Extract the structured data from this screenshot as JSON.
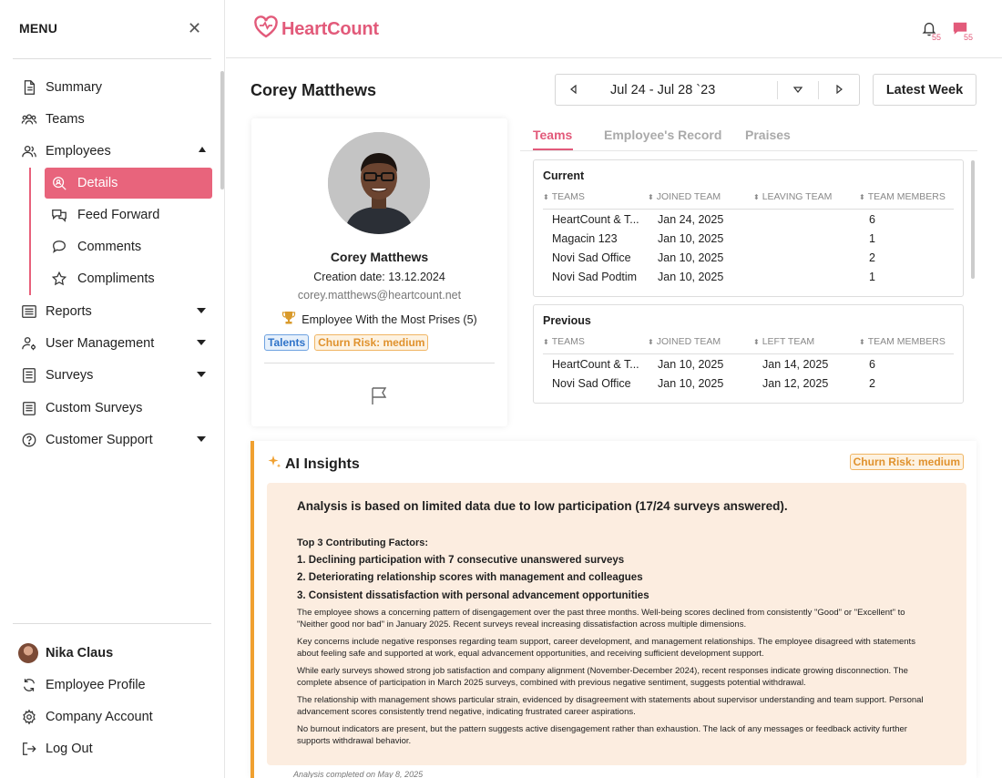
{
  "sidebar": {
    "menu_title": "MENU",
    "close_glyph": "✕",
    "nav": [
      {
        "label": "Summary",
        "icon": "document-icon"
      },
      {
        "label": "Teams",
        "icon": "teams-icon"
      },
      {
        "label": "Employees",
        "icon": "employees-icon"
      }
    ],
    "employees_sub": [
      {
        "label": "Details",
        "icon": "search-user-icon",
        "active": true
      },
      {
        "label": "Feed Forward",
        "icon": "chat-bubbles-icon"
      },
      {
        "label": "Comments",
        "icon": "comment-icon"
      },
      {
        "label": "Compliments",
        "icon": "star-icon"
      }
    ],
    "nav_after": [
      {
        "label": "Reports",
        "icon": "list-icon"
      },
      {
        "label": "User Management",
        "icon": "user-settings-icon"
      },
      {
        "label": "Surveys",
        "icon": "survey-icon"
      },
      {
        "label": "Custom Surveys",
        "icon": "clipboard-icon"
      },
      {
        "label": "Customer Support",
        "icon": "help-icon"
      }
    ],
    "bottom": {
      "user_name": "Nika Claus",
      "employee_profile": "Employee Profile",
      "company_account": "Company Account",
      "log_out": "Log Out"
    }
  },
  "header": {
    "logo_text": "HeartCount",
    "notifications_count": "55",
    "messages_count": "55",
    "brand_color": "#e25a7a"
  },
  "page": {
    "title": "Corey Matthews",
    "date_range": "Jul 24 - Jul 28 `23",
    "latest_week": "Latest Week"
  },
  "profile": {
    "name": "Corey Matthews",
    "creation_date": "Creation date: 13.12.2024",
    "email": "corey.matthews@heartcount.net",
    "award": "Employee With the Most Prises (5)",
    "tags": {
      "talents": "Talents",
      "churn": "Churn Risk: medium"
    }
  },
  "tabs": [
    "Teams",
    "Employee's Record",
    "Praises"
  ],
  "current": {
    "title": "Current",
    "headers": [
      "TEAMS",
      "JOINED TEAM",
      "LEAVING TEAM",
      "TEAM MEMBERS"
    ],
    "rows": [
      [
        "HeartCount & T...",
        "Jan 24, 2025",
        "",
        "6"
      ],
      [
        "Magacin 123",
        "Jan 10, 2025",
        "",
        "1"
      ],
      [
        "Novi Sad Office",
        "Jan 10, 2025",
        "",
        "2"
      ],
      [
        "Novi Sad Podtim",
        "Jan 10, 2025",
        "",
        "1"
      ]
    ]
  },
  "previous": {
    "title": "Previous",
    "headers": [
      "TEAMS",
      "JOINED TEAM",
      "LEFT TEAM",
      "TEAM MEMBERS"
    ],
    "rows": [
      [
        "HeartCount & T...",
        "Jan 10, 2025",
        "Jan 14, 2025",
        "6"
      ],
      [
        "Novi Sad Office",
        "Jan 10, 2025",
        "Jan 12, 2025",
        "2"
      ]
    ]
  },
  "ai": {
    "title": "AI Insights",
    "badge": "Churn Risk: medium",
    "lead": "Analysis is based on limited data due to low participation (17/24 surveys answered).",
    "factors_title": "Top 3 Contributing Factors:",
    "factors": [
      "1. Declining participation with 7 consecutive unanswered surveys",
      "2. Deteriorating relationship scores with management and colleagues",
      "3. Consistent dissatisfaction with personal advancement opportunities"
    ],
    "paragraphs": [
      "The employee shows a concerning pattern of disengagement over the past three months. Well-being scores declined from consistently \"Good\" or \"Excellent\" to \"Neither good nor bad\" in January 2025. Recent surveys reveal increasing dissatisfaction across multiple dimensions.",
      "Key concerns include negative responses regarding team support, career development, and management relationships. The employee disagreed with statements about feeling safe and supported at work, equal advancement opportunities, and receiving sufficient development support.",
      "While early surveys showed strong job satisfaction and company alignment (November-December 2024), recent responses indicate growing disconnection. The complete absence of participation in March 2025 surveys, combined with previous negative sentiment, suggests potential withdrawal.",
      "The relationship with management shows particular strain, evidenced by disagreement with statements about supervisor understanding and team support. Personal advancement scores consistently trend negative, indicating frustrated career aspirations.",
      "No burnout indicators are present, but the pattern suggests active disengagement rather than exhaustion. The lack of any messages or feedback activity further supports withdrawal behavior."
    ],
    "footer": "Analysis completed on May 8, 2025"
  }
}
